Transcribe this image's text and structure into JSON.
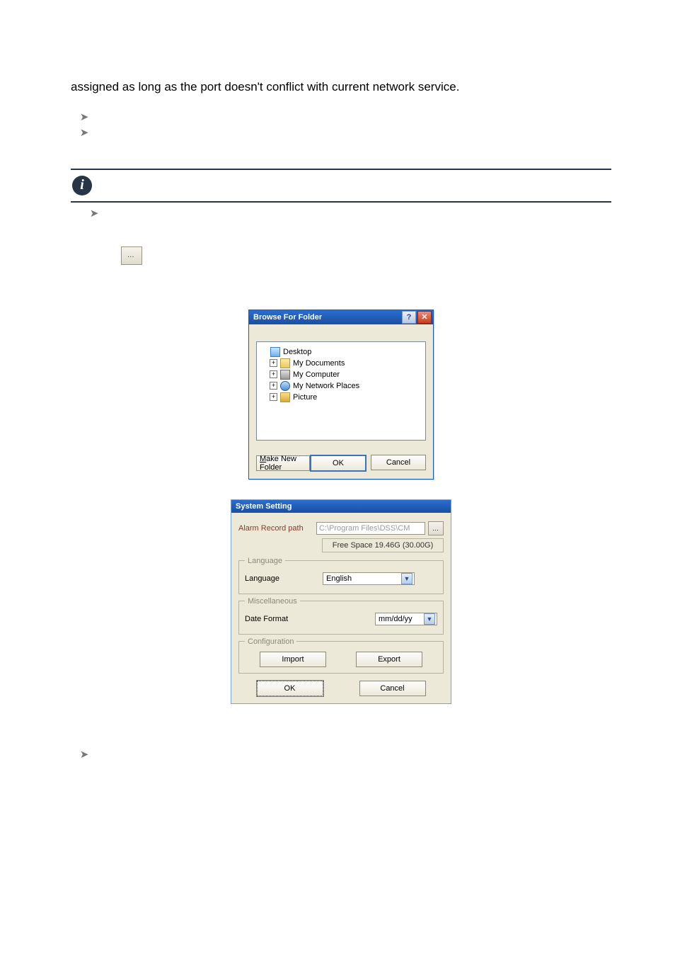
{
  "intro_text": "assigned as long as the port doesn't conflict with current network service.",
  "bullets_top": [
    ""
  ],
  "info_label": "",
  "sub_text": "",
  "indented_text": "",
  "browse_dialog": {
    "title": "Browse For Folder",
    "tree": {
      "desktop": "Desktop",
      "documents": "My Documents",
      "computer": "My Computer",
      "network": "My Network Places",
      "picture": "Picture"
    },
    "make_new_folder": "Make New Folder",
    "make_new_folder_ul": "M",
    "ok": "OK",
    "cancel": "Cancel"
  },
  "system_setting": {
    "title": "System Setting",
    "alarm_label": "Alarm Record path",
    "alarm_value": "C:\\Program Files\\DSS\\CM",
    "free_space": "Free Space 19.46G (30.00G)",
    "language_legend": "Language",
    "language_label": "Language",
    "language_value": "English",
    "misc_legend": "Miscellaneous",
    "date_label": "Date Format",
    "date_value": "mm/dd/yy",
    "config_legend": "Configuration",
    "import": "Import",
    "export": "Export",
    "ok": "OK",
    "cancel": "Cancel"
  }
}
